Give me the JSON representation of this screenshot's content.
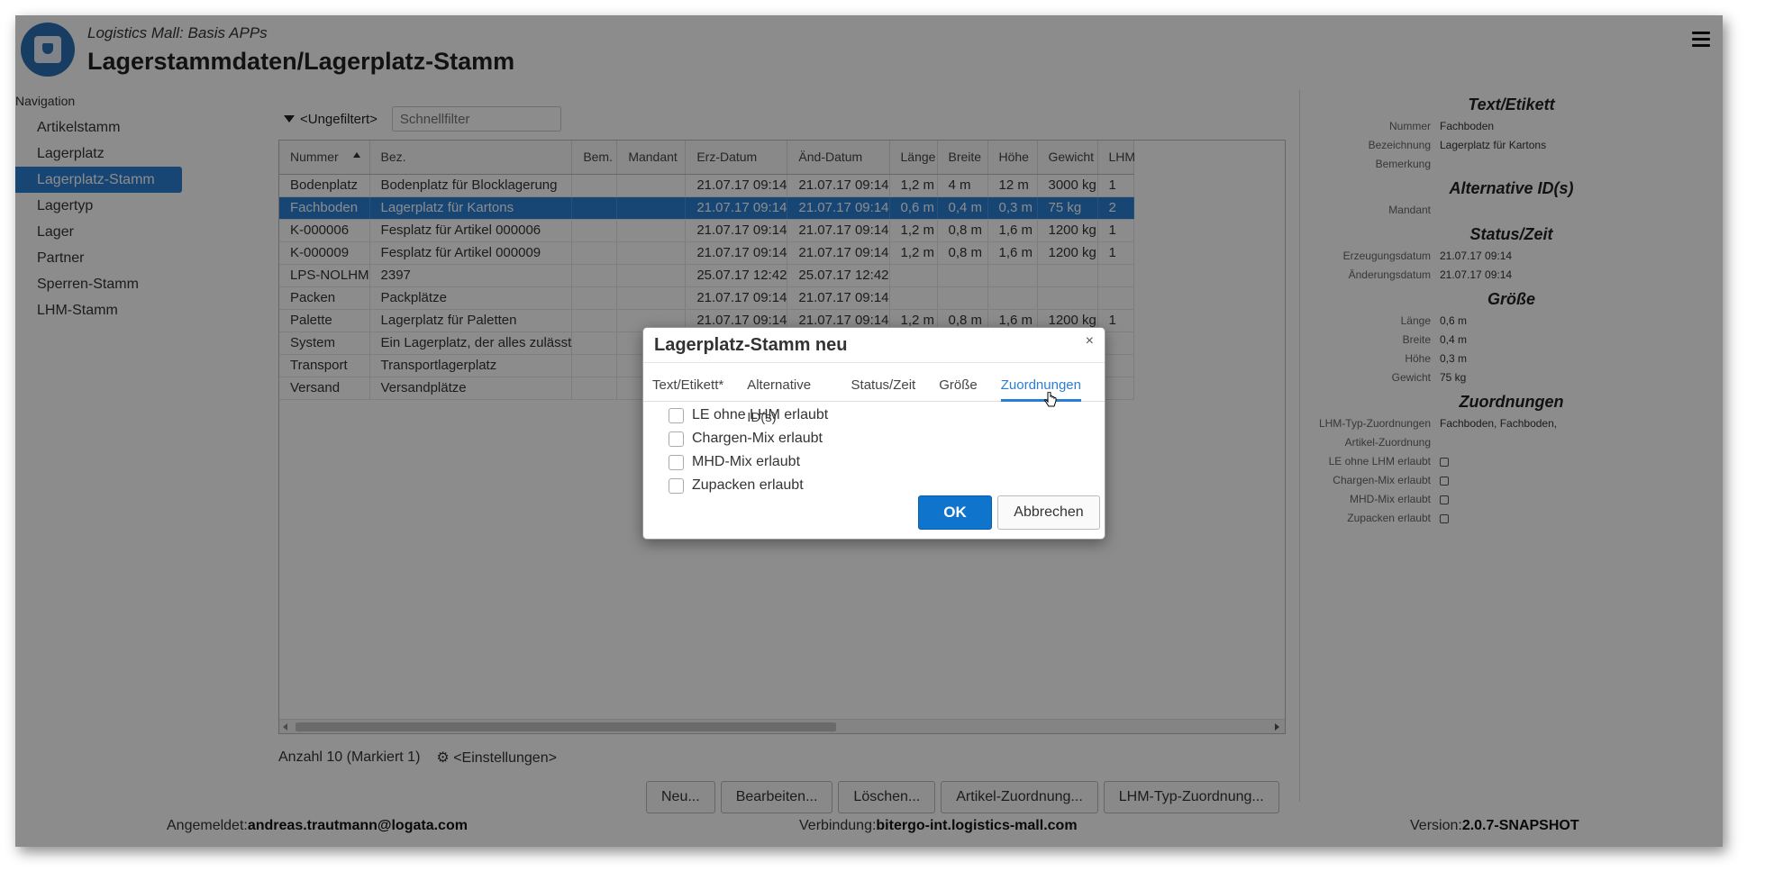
{
  "header": {
    "subtitle": "Logistics Mall: Basis APPs",
    "title": "Lagerstammdaten/Lagerplatz-Stamm"
  },
  "nav": {
    "label": "Navigation",
    "items": [
      {
        "label": "Artikelstamm"
      },
      {
        "label": "Lagerplatz"
      },
      {
        "label": "Lagerplatz-Stamm",
        "active": true
      },
      {
        "label": "Lagertyp"
      },
      {
        "label": "Lager"
      },
      {
        "label": "Partner"
      },
      {
        "label": "Sperren-Stamm"
      },
      {
        "label": "LHM-Stamm"
      }
    ]
  },
  "filter": {
    "label": "<Ungefiltert>",
    "placeholder": "Schnellfilter"
  },
  "grid": {
    "columns": [
      "Nummer",
      "Bez.",
      "Bem.",
      "Mandant",
      "Erz-Datum",
      "Änd-Datum",
      "Länge",
      "Breite",
      "Höhe",
      "Gewicht",
      "LHM"
    ],
    "rows": [
      [
        "Bodenplatz",
        "Bodenplatz für Blocklagerung",
        "",
        "",
        "21.07.17 09:14",
        "21.07.17 09:14",
        "1,2 m",
        "4 m",
        "12 m",
        "3000 kg",
        "1"
      ],
      [
        "Fachboden",
        "Lagerplatz für Kartons",
        "",
        "",
        "21.07.17 09:14",
        "21.07.17 09:14",
        "0,6 m",
        "0,4 m",
        "0,3 m",
        "75 kg",
        "2"
      ],
      [
        "K-000006",
        "Fesplatz für Artikel 000006",
        "",
        "",
        "21.07.17 09:14",
        "21.07.17 09:14",
        "1,2 m",
        "0,8 m",
        "1,6 m",
        "1200 kg",
        "1"
      ],
      [
        "K-000009",
        "Fesplatz für Artikel 000009",
        "",
        "",
        "21.07.17 09:14",
        "21.07.17 09:14",
        "1,2 m",
        "0,8 m",
        "1,6 m",
        "1200 kg",
        "1"
      ],
      [
        "LPS-NOLHM",
        "2397",
        "",
        "",
        "25.07.17 12:42",
        "25.07.17 12:42",
        "",
        "",
        "",
        "",
        ""
      ],
      [
        "Packen",
        "Packplätze",
        "",
        "",
        "21.07.17 09:14",
        "21.07.17 09:14",
        "",
        "",
        "",
        "",
        ""
      ],
      [
        "Palette",
        "Lagerplatz für Paletten",
        "",
        "",
        "21.07.17 09:14",
        "21.07.17 09:14",
        "1,2 m",
        "0,8 m",
        "1,6 m",
        "1200 kg",
        "1"
      ],
      [
        "System",
        "Ein Lagerplatz, der alles zulässt",
        "",
        "",
        "",
        "",
        "",
        "",
        "",
        "",
        ""
      ],
      [
        "Transport",
        "Transportlagerplatz",
        "",
        "",
        "",
        "",
        "",
        "",
        "",
        "",
        ""
      ],
      [
        "Versand",
        "Versandplätze",
        "",
        "",
        "",
        "",
        "",
        "",
        "",
        "",
        ""
      ]
    ],
    "selected_row": 1
  },
  "footer": {
    "count_label": "Anzahl 10 (Markiert 1)",
    "settings_label": "<Einstellungen>"
  },
  "buttons": [
    "Neu...",
    "Bearbeiten...",
    "Löschen...",
    "Artikel-Zuordnung...",
    "LHM-Typ-Zuordnung..."
  ],
  "details": {
    "sections": [
      {
        "title": "Text/Etikett",
        "rows": [
          {
            "k": "Nummer",
            "v": "Fachboden"
          },
          {
            "k": "Bezeichnung",
            "v": "Lagerplatz für Kartons"
          },
          {
            "k": "Bemerkung",
            "v": ""
          }
        ]
      },
      {
        "title": "Alternative ID(s)",
        "rows": [
          {
            "k": "Mandant",
            "v": ""
          }
        ]
      },
      {
        "title": "Status/Zeit",
        "rows": [
          {
            "k": "Erzeugungsdatum",
            "v": "21.07.17 09:14"
          },
          {
            "k": "Änderungsdatum",
            "v": "21.07.17 09:14"
          }
        ]
      },
      {
        "title": "Größe",
        "rows": [
          {
            "k": "Länge",
            "v": "0,6 m"
          },
          {
            "k": "Breite",
            "v": "0,4 m"
          },
          {
            "k": "Höhe",
            "v": "0,3 m"
          },
          {
            "k": "Gewicht",
            "v": "75 kg"
          }
        ]
      },
      {
        "title": "Zuordnungen",
        "rows": [
          {
            "k": "LHM-Typ-Zuordnungen",
            "v": "Fachboden, Fachboden,"
          },
          {
            "k": "Artikel-Zuordnung",
            "v": ""
          },
          {
            "k": "LE ohne LHM erlaubt",
            "v": "",
            "checkbox": true
          },
          {
            "k": "Chargen-Mix erlaubt",
            "v": "",
            "checkbox": true
          },
          {
            "k": "MHD-Mix erlaubt",
            "v": "",
            "checkbox": true
          },
          {
            "k": "Zupacken erlaubt",
            "v": "",
            "checkbox": true
          }
        ]
      }
    ]
  },
  "status": {
    "logged_in_label": "Angemeldet:",
    "logged_in_user": "andreas.trautmann@logata.com",
    "connection_label": "Verbindung:",
    "connection_host": "bitergo-int.logistics-mall.com",
    "version_label": "Version:",
    "version_value": "2.0.7-SNAPSHOT"
  },
  "modal": {
    "title": "Lagerplatz-Stamm neu",
    "close": "×",
    "tabs": [
      {
        "label": "Text/Etikett*"
      },
      {
        "label": "Alternative ID(s)"
      },
      {
        "label": "Status/Zeit"
      },
      {
        "label": "Größe"
      },
      {
        "label": "Zuordnungen",
        "active": true
      }
    ],
    "checkboxes": [
      {
        "label": "LE ohne LHM erlaubt",
        "checked": false
      },
      {
        "label": "Chargen-Mix erlaubt",
        "checked": false
      },
      {
        "label": "MHD-Mix erlaubt",
        "checked": false
      },
      {
        "label": "Zupacken erlaubt",
        "checked": false
      }
    ],
    "ok_label": "OK",
    "cancel_label": "Abbrechen"
  },
  "colors": {
    "accent": "#2a7fd4",
    "ok_button": "#0e74cc"
  }
}
